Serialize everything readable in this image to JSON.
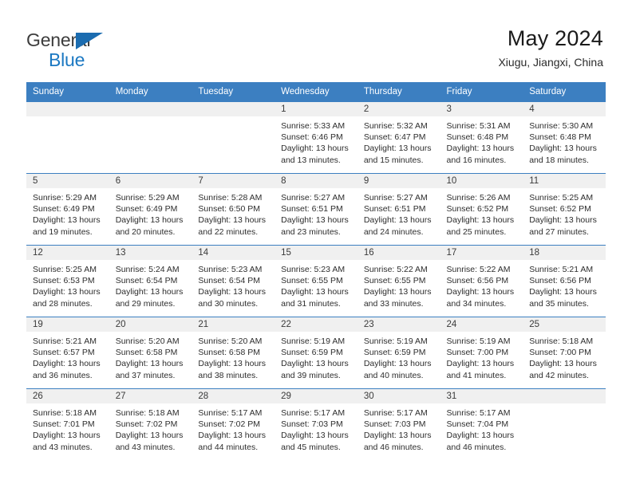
{
  "brand": {
    "name_top": "General",
    "name_bottom": "Blue",
    "triangle_color": "#1b6cb0",
    "blue_color": "#1b78c2"
  },
  "header": {
    "title": "May 2024",
    "subtitle": "Xiugu, Jiangxi, China"
  },
  "theme": {
    "header_row_bg": "#3c7fc1",
    "daynum_bg": "#f0f0f0",
    "text_color": "#2d2d2d"
  },
  "weekdays": [
    "Sunday",
    "Monday",
    "Tuesday",
    "Wednesday",
    "Thursday",
    "Friday",
    "Saturday"
  ],
  "labels": {
    "sunrise": "Sunrise:",
    "sunset": "Sunset:",
    "daylight": "Daylight:"
  },
  "weeks": [
    [
      {
        "day": "",
        "empty": true
      },
      {
        "day": "",
        "empty": true
      },
      {
        "day": "",
        "empty": true
      },
      {
        "day": "1",
        "sunrise": "Sunrise: 5:33 AM",
        "sunset": "Sunset: 6:46 PM",
        "daylight": "Daylight: 13 hours and 13 minutes."
      },
      {
        "day": "2",
        "sunrise": "Sunrise: 5:32 AM",
        "sunset": "Sunset: 6:47 PM",
        "daylight": "Daylight: 13 hours and 15 minutes."
      },
      {
        "day": "3",
        "sunrise": "Sunrise: 5:31 AM",
        "sunset": "Sunset: 6:48 PM",
        "daylight": "Daylight: 13 hours and 16 minutes."
      },
      {
        "day": "4",
        "sunrise": "Sunrise: 5:30 AM",
        "sunset": "Sunset: 6:48 PM",
        "daylight": "Daylight: 13 hours and 18 minutes."
      }
    ],
    [
      {
        "day": "5",
        "sunrise": "Sunrise: 5:29 AM",
        "sunset": "Sunset: 6:49 PM",
        "daylight": "Daylight: 13 hours and 19 minutes."
      },
      {
        "day": "6",
        "sunrise": "Sunrise: 5:29 AM",
        "sunset": "Sunset: 6:49 PM",
        "daylight": "Daylight: 13 hours and 20 minutes."
      },
      {
        "day": "7",
        "sunrise": "Sunrise: 5:28 AM",
        "sunset": "Sunset: 6:50 PM",
        "daylight": "Daylight: 13 hours and 22 minutes."
      },
      {
        "day": "8",
        "sunrise": "Sunrise: 5:27 AM",
        "sunset": "Sunset: 6:51 PM",
        "daylight": "Daylight: 13 hours and 23 minutes."
      },
      {
        "day": "9",
        "sunrise": "Sunrise: 5:27 AM",
        "sunset": "Sunset: 6:51 PM",
        "daylight": "Daylight: 13 hours and 24 minutes."
      },
      {
        "day": "10",
        "sunrise": "Sunrise: 5:26 AM",
        "sunset": "Sunset: 6:52 PM",
        "daylight": "Daylight: 13 hours and 25 minutes."
      },
      {
        "day": "11",
        "sunrise": "Sunrise: 5:25 AM",
        "sunset": "Sunset: 6:52 PM",
        "daylight": "Daylight: 13 hours and 27 minutes."
      }
    ],
    [
      {
        "day": "12",
        "sunrise": "Sunrise: 5:25 AM",
        "sunset": "Sunset: 6:53 PM",
        "daylight": "Daylight: 13 hours and 28 minutes."
      },
      {
        "day": "13",
        "sunrise": "Sunrise: 5:24 AM",
        "sunset": "Sunset: 6:54 PM",
        "daylight": "Daylight: 13 hours and 29 minutes."
      },
      {
        "day": "14",
        "sunrise": "Sunrise: 5:23 AM",
        "sunset": "Sunset: 6:54 PM",
        "daylight": "Daylight: 13 hours and 30 minutes."
      },
      {
        "day": "15",
        "sunrise": "Sunrise: 5:23 AM",
        "sunset": "Sunset: 6:55 PM",
        "daylight": "Daylight: 13 hours and 31 minutes."
      },
      {
        "day": "16",
        "sunrise": "Sunrise: 5:22 AM",
        "sunset": "Sunset: 6:55 PM",
        "daylight": "Daylight: 13 hours and 33 minutes."
      },
      {
        "day": "17",
        "sunrise": "Sunrise: 5:22 AM",
        "sunset": "Sunset: 6:56 PM",
        "daylight": "Daylight: 13 hours and 34 minutes."
      },
      {
        "day": "18",
        "sunrise": "Sunrise: 5:21 AM",
        "sunset": "Sunset: 6:56 PM",
        "daylight": "Daylight: 13 hours and 35 minutes."
      }
    ],
    [
      {
        "day": "19",
        "sunrise": "Sunrise: 5:21 AM",
        "sunset": "Sunset: 6:57 PM",
        "daylight": "Daylight: 13 hours and 36 minutes."
      },
      {
        "day": "20",
        "sunrise": "Sunrise: 5:20 AM",
        "sunset": "Sunset: 6:58 PM",
        "daylight": "Daylight: 13 hours and 37 minutes."
      },
      {
        "day": "21",
        "sunrise": "Sunrise: 5:20 AM",
        "sunset": "Sunset: 6:58 PM",
        "daylight": "Daylight: 13 hours and 38 minutes."
      },
      {
        "day": "22",
        "sunrise": "Sunrise: 5:19 AM",
        "sunset": "Sunset: 6:59 PM",
        "daylight": "Daylight: 13 hours and 39 minutes."
      },
      {
        "day": "23",
        "sunrise": "Sunrise: 5:19 AM",
        "sunset": "Sunset: 6:59 PM",
        "daylight": "Daylight: 13 hours and 40 minutes."
      },
      {
        "day": "24",
        "sunrise": "Sunrise: 5:19 AM",
        "sunset": "Sunset: 7:00 PM",
        "daylight": "Daylight: 13 hours and 41 minutes."
      },
      {
        "day": "25",
        "sunrise": "Sunrise: 5:18 AM",
        "sunset": "Sunset: 7:00 PM",
        "daylight": "Daylight: 13 hours and 42 minutes."
      }
    ],
    [
      {
        "day": "26",
        "sunrise": "Sunrise: 5:18 AM",
        "sunset": "Sunset: 7:01 PM",
        "daylight": "Daylight: 13 hours and 43 minutes."
      },
      {
        "day": "27",
        "sunrise": "Sunrise: 5:18 AM",
        "sunset": "Sunset: 7:02 PM",
        "daylight": "Daylight: 13 hours and 43 minutes."
      },
      {
        "day": "28",
        "sunrise": "Sunrise: 5:17 AM",
        "sunset": "Sunset: 7:02 PM",
        "daylight": "Daylight: 13 hours and 44 minutes."
      },
      {
        "day": "29",
        "sunrise": "Sunrise: 5:17 AM",
        "sunset": "Sunset: 7:03 PM",
        "daylight": "Daylight: 13 hours and 45 minutes."
      },
      {
        "day": "30",
        "sunrise": "Sunrise: 5:17 AM",
        "sunset": "Sunset: 7:03 PM",
        "daylight": "Daylight: 13 hours and 46 minutes."
      },
      {
        "day": "31",
        "sunrise": "Sunrise: 5:17 AM",
        "sunset": "Sunset: 7:04 PM",
        "daylight": "Daylight: 13 hours and 46 minutes."
      },
      {
        "day": "",
        "empty": true
      }
    ]
  ]
}
